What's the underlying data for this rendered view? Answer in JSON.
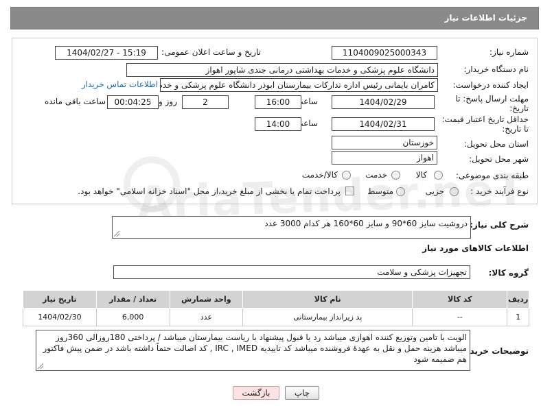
{
  "header": {
    "title": "جزئیات اطلاعات نیاز"
  },
  "form": {
    "need_number": {
      "label": "شماره نیاز:",
      "value": "1104009025000343"
    },
    "announce_datetime": {
      "label": "تاریخ و ساعت اعلان عمومی:",
      "value": "1404/02/27 - 15:19"
    },
    "buyer_org": {
      "label": "نام دستگاه خریدار:",
      "value": "دانشگاه علوم پزشکی و خدمات بهداشتی درمانی جندی شاپور اهواز"
    },
    "requester": {
      "label": "ایجاد کننده درخواست:",
      "value": "کامران بایمانی رئیس اداره تدارکات بیمارستان ابوذر  دانشگاه علوم پزشکی و خدم",
      "contact_link": "اطلاعات تماس خریدار"
    },
    "reply_deadline": {
      "label_line1": "مهلت ارسال پاسخ: تا",
      "label_line2": "تاریخ:",
      "date": "1404/02/29",
      "time_label": "ساعت",
      "time": "16:00",
      "days": "2",
      "days_label": "روز و",
      "remaining": "00:04:25",
      "remaining_label": "ساعت باقی مانده"
    },
    "price_validity": {
      "label_line1": "حداقل تاریخ اعتبار قیمت:",
      "label_line2": "تا تاریخ:",
      "date": "1404/02/31",
      "time_label": "ساعت",
      "time": "14:00"
    },
    "delivery_province": {
      "label": "استان محل تحویل:",
      "value": "خوزستان"
    },
    "delivery_city": {
      "label": "شهر محل تحویل:",
      "value": "اهواز"
    },
    "category": {
      "label": "طبقه بندی موضوعی:",
      "options": [
        "کالا",
        "خدمت",
        "کالا/خدمت"
      ]
    },
    "purchase_type": {
      "label": "نوع فرآیند خرید :",
      "options": [
        "جزیی",
        "متوسط"
      ],
      "payment_note": "پرداخت تمام یا بخشی از مبلغ خرید،از محل \"اسناد خزانه اسلامی\" خواهد بود."
    }
  },
  "description": {
    "label": "شرح کلی نیاز:",
    "value": "دروشیت سایز  60*90 و  سایز 60*160   هر کدام 3000 عدد"
  },
  "goods_section": {
    "title": "اطلاعات کالاهای مورد نیاز",
    "group_label": "گروه کالا:",
    "group_value": "تجهیزات پزشکی و سلامت"
  },
  "goods_table": {
    "headers": [
      "ردیف",
      "کد کالا",
      "نام کالا",
      "واحد شمارش",
      "تعداد / مقدار",
      "تاریخ نیاز"
    ],
    "rows": [
      {
        "row": "1",
        "code": "--",
        "name": "پد زیرانداز بیمارستانی",
        "unit": "عدد",
        "qty": "6,000",
        "date": "1404/02/30"
      }
    ]
  },
  "buyer_notes": {
    "label": "توضیحات خریدار:",
    "value": "الویت با تامین وتوزیع کننده اهوازی  میباشد رد یا قبول پیشنهاد با ریاست بیمارستان میباشد / پرداختی 180روزالی 360روز میباشد  هزینه حمل و نقل به عهدهٔ فروشنده میباشد   کد تاییدیه IRC , IMED , کد اصالت حتماً داشته باشد در ضمن پیش فاکتور هم ضمیمه شود"
  },
  "buttons": {
    "print": "چاپ",
    "back": "بازگشت"
  }
}
